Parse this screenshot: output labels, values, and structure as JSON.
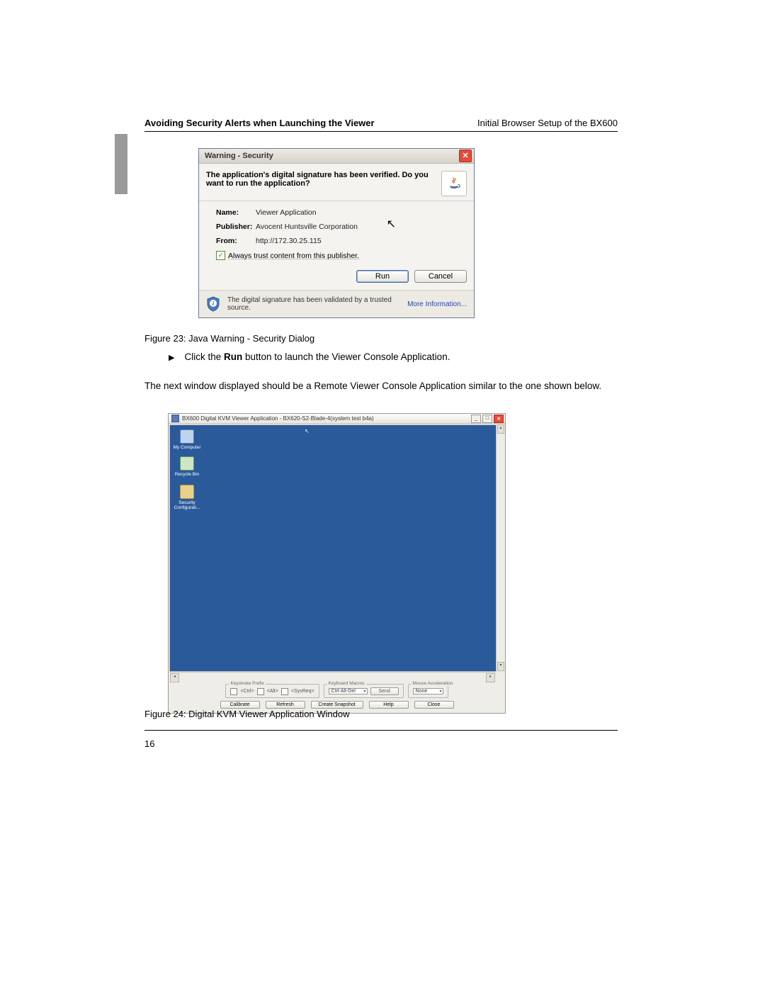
{
  "header": {
    "left": "Avoiding Security Alerts when Launching the Viewer",
    "right": "Initial Browser Setup of the BX600"
  },
  "security_dialog": {
    "title": "Warning - Security",
    "question": "The application's digital signature has been verified. Do you want to run the application?",
    "fields": {
      "name_label": "Name:",
      "name_value": "Viewer Application",
      "publisher_label": "Publisher:",
      "publisher_value": "Avocent Huntsville Corporation",
      "from_label": "From:",
      "from_value": "http://172.30.25.115"
    },
    "trust_checkbox_label": "Always trust content from this publisher.",
    "run_button": "Run",
    "cancel_button": "Cancel",
    "footer_text": "The digital signature has been validated by a trusted source.",
    "more_info": "More Information..."
  },
  "fig23_caption": "Figure 23: Java Warning - Security Dialog",
  "bullet_text_pre": "Click the ",
  "bullet_text_bold": "Run",
  "bullet_text_post": " button to launch the Viewer Console Application.",
  "paragraph": "The next window displayed should be a Remote Viewer Console Application similar to the one shown below.",
  "viewer": {
    "title": "BX600 Digital KVM Viewer Application - BX620-S2-Blade-4(system test b4a)",
    "icons": {
      "my_computer": "My Computer",
      "recycle_bin": "Recycle Bin",
      "security_config": "Security Configurati..."
    },
    "groups": {
      "keystroke_prefix": "Keystroke Prefix",
      "keyboard_macros": "Keyboard Macros",
      "mouse_acceleration": "Mouse Acceleration"
    },
    "prefix": {
      "ctrl": "<Ctrl>",
      "alt": "<Alt>",
      "sysreq": "<SysReq>"
    },
    "macro_value": "Ctrl-Alt-Del",
    "send_button": "Send",
    "accel_value": "None",
    "buttons": {
      "calibrate": "Calibrate",
      "refresh": "Refresh",
      "snapshot": "Create Snapshot",
      "help": "Help",
      "close": "Close"
    }
  },
  "fig24_caption": "Figure 24: Digital KVM Viewer Application Window",
  "page_number": "16"
}
